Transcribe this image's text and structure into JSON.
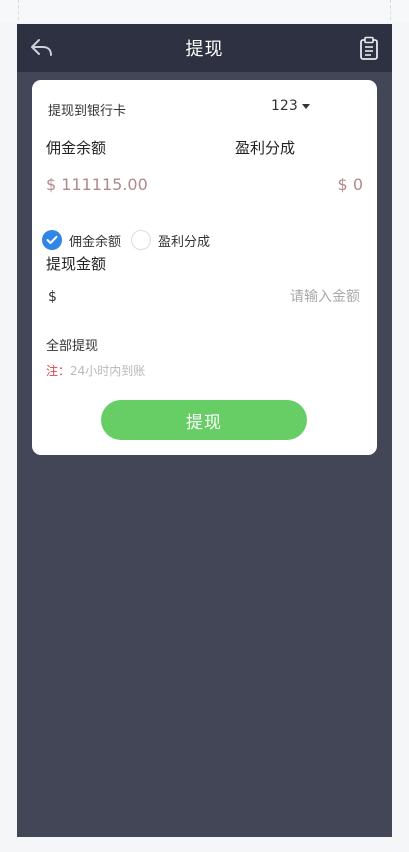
{
  "header": {
    "title": "提现",
    "back_icon": "back-arrow-icon",
    "right_icon": "clipboard-icon"
  },
  "card": {
    "bank": {
      "label": "提现到银行卡",
      "selected": "123"
    },
    "balances": {
      "left_label": "佣金余额",
      "left_value": "$ 111115.00",
      "right_label": "盈利分成",
      "right_value": "$ 0"
    },
    "radios": [
      {
        "label": "佣金余额",
        "checked": true
      },
      {
        "label": "盈利分成",
        "checked": false
      }
    ],
    "amount": {
      "label": "提现金额",
      "currency": "$",
      "placeholder": "请输入金额",
      "value": ""
    },
    "withdraw_all": "全部提现",
    "note": {
      "prefix": "注：",
      "text": "24小时内到账"
    },
    "submit_label": "提现"
  },
  "colors": {
    "header_bg": "#2e3142",
    "page_bg": "#434657",
    "accent_blue": "#2f86e4",
    "button_green": "#67ce66",
    "note_red": "#e0424a",
    "balance_text": "#b08a8a"
  }
}
